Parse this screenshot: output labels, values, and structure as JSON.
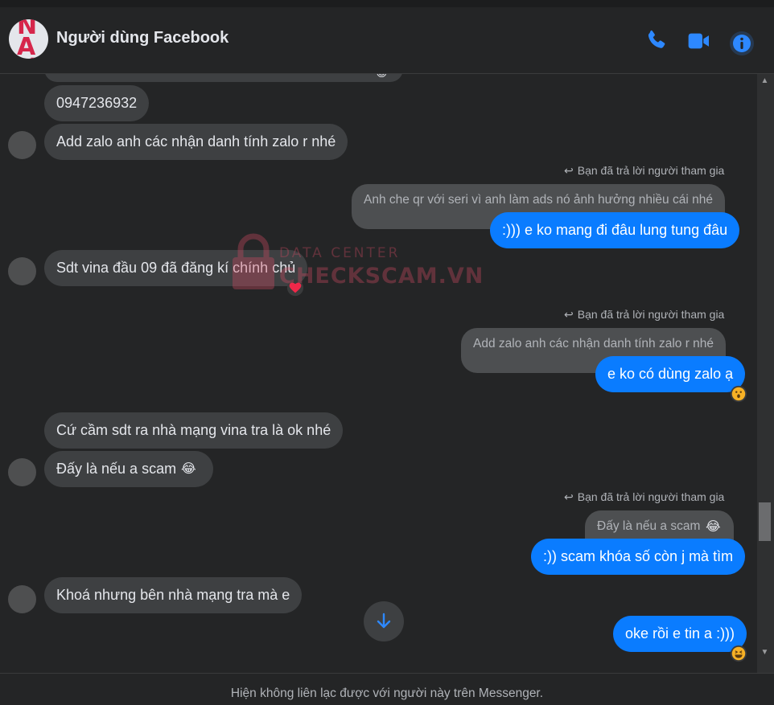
{
  "header": {
    "title": "Người dùng Facebook",
    "avatar_watermark": "NÀ V"
  },
  "messages": {
    "m0_phone": "0947236932",
    "m1": "Add zalo anh các nhận danh tính zalo r nhé",
    "reply_note_1": "Bạn đã trả lời người tham gia",
    "quoted_1": "Anh che qr với seri vì anh làm ads nó ảnh hưởng nhiều cái nhé",
    "out_1": ":))) e ko mang đi đâu lung tung đâu",
    "m2": "Sdt vina đầu 09 đã đăng kí chính chủ",
    "reply_note_2": "Bạn đã trả lời người tham gia",
    "quoted_2": "Add zalo anh các nhận danh tính zalo r nhé",
    "out_2": "e ko có dùng zalo ạ",
    "m3": "Cứ cầm sdt ra nhà mạng vina tra là ok nhé",
    "m4": "Đấy là nếu a scam",
    "reply_note_3": "Bạn đã trả lời người tham gia",
    "quoted_3": "Đấy là nếu a scam",
    "out_3": ":)) scam khóa số còn j mà tìm",
    "m5": "Khoá nhưng bên nhà mạng tra mà e",
    "out_4": "oke rồi e tin a :)))"
  },
  "emoji": {
    "laugh_cry": "😂"
  },
  "watermark": {
    "top": "DATA CENTER",
    "bottom": "CHECKSCAM.VN"
  },
  "footer": {
    "text": "Hiện không liên lạc được với người này trên Messenger."
  },
  "colors": {
    "accent": "#0a7cff",
    "background": "#242526",
    "incoming_bubble": "#3e4042"
  }
}
